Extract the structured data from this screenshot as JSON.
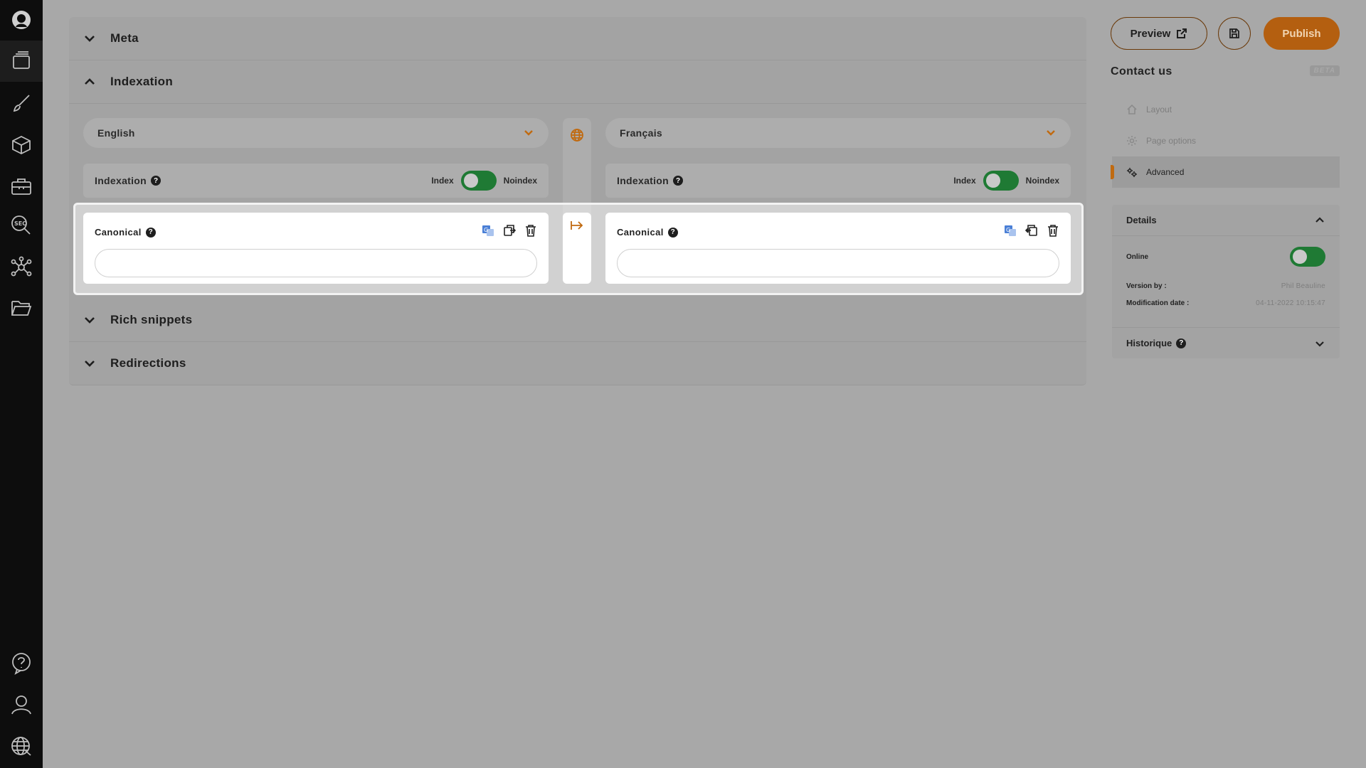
{
  "rail": {
    "top_icons": [
      "avatar-icon",
      "pages-icon",
      "brush-icon",
      "cube-icon",
      "toolbox-icon",
      "seo-icon",
      "network-icon",
      "folder-icon"
    ],
    "bottom_icons": [
      "help-icon",
      "user-icon",
      "globe-icon"
    ],
    "seo_text": "SEO"
  },
  "main": {
    "sections": {
      "meta": "Meta",
      "indexation": "Indexation",
      "rich_snippets": "Rich snippets",
      "redirections": "Redirections"
    },
    "left": {
      "language": "English",
      "indexation_label": "Indexation",
      "index_label": "Index",
      "noindex_label": "Noindex",
      "canonical_label": "Canonical",
      "canonical_value": ""
    },
    "right": {
      "language": "Français",
      "indexation_label": "Indexation",
      "index_label": "Index",
      "noindex_label": "Noindex",
      "canonical_label": "Canonical",
      "canonical_value": ""
    },
    "help_glyph": "?"
  },
  "panel": {
    "preview_label": "Preview",
    "publish_label": "Publish",
    "page_title": "Contact us",
    "beta_label": "BETA",
    "nav": [
      {
        "label": "Layout",
        "icon": "home-icon",
        "active": false
      },
      {
        "label": "Page options",
        "icon": "gear-icon",
        "active": false
      },
      {
        "label": "Advanced",
        "icon": "gears-icon",
        "active": true
      }
    ],
    "details": {
      "title": "Details",
      "online_label": "Online",
      "version_by_label": "Version by :",
      "version_by_value": "Phil Beauline",
      "modification_label": "Modification date :",
      "modification_value": "04-11-2022 10:15:47",
      "history_label": "Historique"
    }
  },
  "colors": {
    "accent": "#c06a10",
    "publish_bg": "#b45f10",
    "toggle_on": "#1f7a34",
    "rail_bg": "#0d0d0d"
  }
}
